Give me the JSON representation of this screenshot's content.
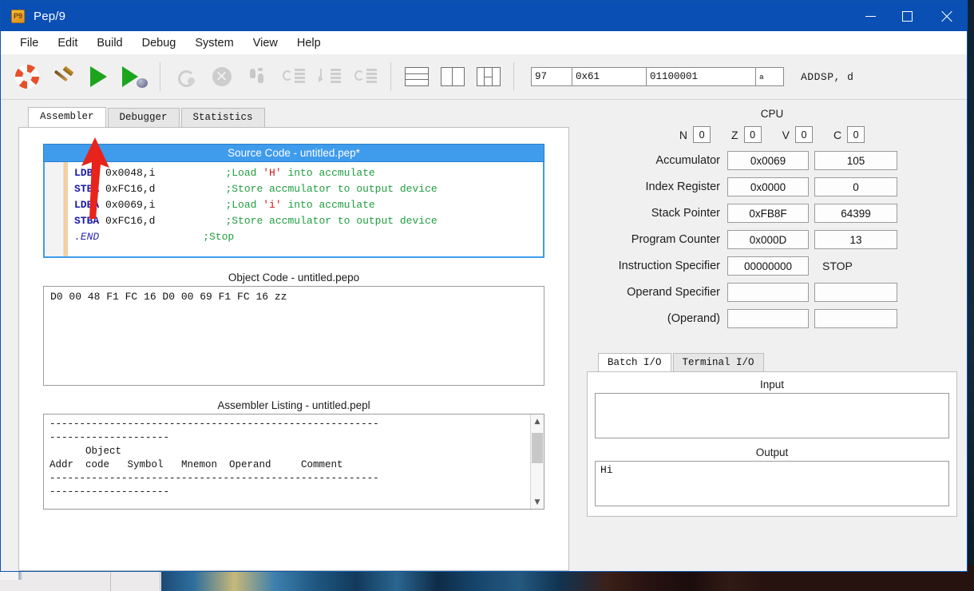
{
  "window": {
    "title": "Pep/9",
    "app_icon_text": "P9",
    "controls": {
      "minimize": "minimize-icon",
      "maximize": "maximize-icon",
      "close": "close-icon"
    }
  },
  "menu": {
    "items": [
      "File",
      "Edit",
      "Build",
      "Debug",
      "System",
      "View",
      "Help"
    ]
  },
  "toolbar": {
    "buttons": [
      {
        "name": "help-lifering-button",
        "icon": "life-ring-icon",
        "enabled": true
      },
      {
        "name": "assemble-button",
        "icon": "hammer-icon",
        "enabled": true
      },
      {
        "name": "run-button",
        "icon": "play-icon",
        "enabled": true
      },
      {
        "name": "run-debugger-button",
        "icon": "play-debug-icon",
        "enabled": true
      },
      {
        "name": "continue-button",
        "icon": "loop-icon",
        "enabled": false
      },
      {
        "name": "stop-debugging-button",
        "icon": "stop-x-icon",
        "enabled": false
      },
      {
        "name": "single-step-button",
        "icon": "footsteps-icon",
        "enabled": false
      },
      {
        "name": "step-over-button",
        "icon": "step-over-icon",
        "enabled": false
      },
      {
        "name": "step-into-button",
        "icon": "step-into-icon",
        "enabled": false
      },
      {
        "name": "step-out-button",
        "icon": "step-out-icon",
        "enabled": false
      },
      {
        "name": "view-code-only-button",
        "icon": "layout-rows-icon",
        "enabled": true
      },
      {
        "name": "view-code-cpu-button",
        "icon": "layout-split-icon",
        "enabled": true
      },
      {
        "name": "view-code-cpu-memory-button",
        "icon": "layout-three-icon",
        "enabled": true
      }
    ],
    "status": {
      "decimal": "97",
      "hex": "0x61",
      "binary": "01100001",
      "ascii": "a",
      "mnemonic": "ADDSP, d"
    }
  },
  "annotation": {
    "type": "red-arrow",
    "points_to": "run-button"
  },
  "tabs": {
    "items": [
      "Assembler",
      "Debugger",
      "Statistics"
    ],
    "active": "Assembler"
  },
  "source_code": {
    "title": "Source Code - untitled.pep*",
    "lines": [
      {
        "mnemonic": "LDBA",
        "operand": "0x0048,i",
        "comment_pre": ";Load ",
        "char_literal": "'H'",
        "comment_post": " into accmulate"
      },
      {
        "mnemonic": "STBA",
        "operand": "0xFC16,d",
        "comment_pre": ";Store accmulator to output device",
        "char_literal": "",
        "comment_post": ""
      },
      {
        "mnemonic": "LDBA",
        "operand": "0x0069,i",
        "comment_pre": ";Load ",
        "char_literal": "'i'",
        "comment_post": " into accmulate"
      },
      {
        "mnemonic": "STBA",
        "operand": "0xFC16,d",
        "comment_pre": ";Store accmulator to output device",
        "char_literal": "",
        "comment_post": ""
      },
      {
        "mnemonic": ".END",
        "operand": "",
        "comment_pre": ";Stop",
        "char_literal": "",
        "comment_post": ""
      }
    ]
  },
  "object_code": {
    "title": "Object Code - untitled.pepo",
    "content": "D0 00 48 F1 FC 16 D0 00 69 F1 FC 16 zz"
  },
  "assembler_listing": {
    "title": "Assembler Listing - untitled.pepl",
    "content": "-------------------------------------------------------\n--------------------\n      Object\nAddr  code   Symbol   Mnemon  Operand     Comment\n-------------------------------------------------------\n--------------------",
    "scrollbar": {
      "up": "▲",
      "down": "▼"
    }
  },
  "cpu": {
    "title": "CPU",
    "flags": [
      {
        "label": "N",
        "value": "0"
      },
      {
        "label": "Z",
        "value": "0"
      },
      {
        "label": "V",
        "value": "0"
      },
      {
        "label": "C",
        "value": "0"
      }
    ],
    "registers": [
      {
        "label": "Accumulator",
        "hex": "0x0069",
        "dec": "105"
      },
      {
        "label": "Index Register",
        "hex": "0x0000",
        "dec": "0"
      },
      {
        "label": "Stack Pointer",
        "hex": "0xFB8F",
        "dec": "64399"
      },
      {
        "label": "Program Counter",
        "hex": "0x000D",
        "dec": "13"
      },
      {
        "label": "Instruction Specifier",
        "hex": "00000000",
        "dec": "STOP",
        "dec_plain": true
      },
      {
        "label": "Operand Specifier",
        "hex": "",
        "dec": ""
      },
      {
        "label": "(Operand)",
        "hex": "",
        "dec": ""
      }
    ]
  },
  "io": {
    "tabs": [
      "Batch I/O",
      "Terminal I/O"
    ],
    "active": "Batch I/O",
    "input_label": "Input",
    "input_value": "",
    "output_label": "Output",
    "output_value": "Hi"
  },
  "colors": {
    "title_bar": "#0a4fb3",
    "accent_highlight": "#3f9bec",
    "mnemonic": "#1a1aa8",
    "comment": "#1e9e3e",
    "char_literal": "#d01414",
    "run_green": "#1ca51c",
    "annotation_red": "#e8231b"
  }
}
